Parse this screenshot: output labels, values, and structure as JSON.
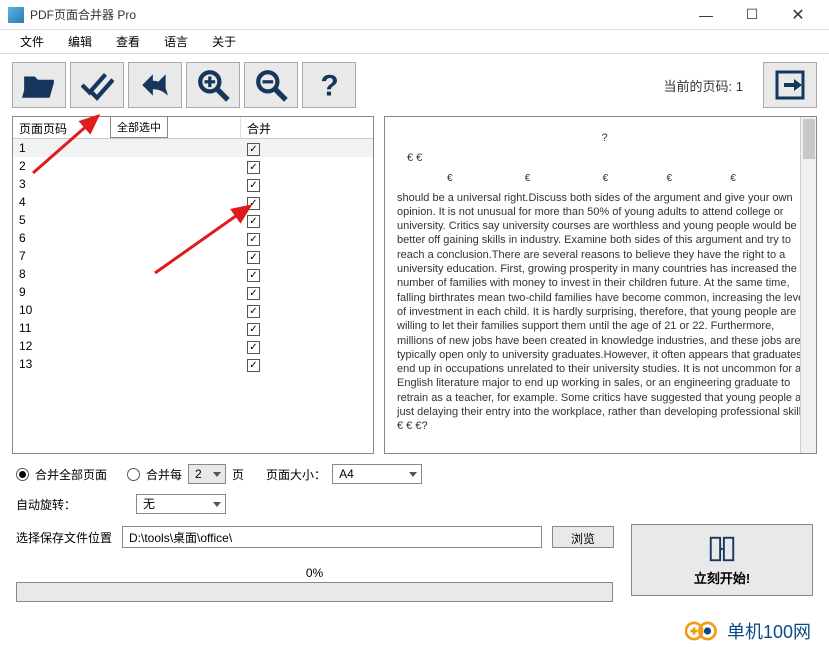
{
  "window": {
    "title": "PDF页面合并器 Pro"
  },
  "menu": {
    "file": "文件",
    "edit": "编辑",
    "view": "查看",
    "lang": "语言",
    "about": "关于"
  },
  "tooltip": "全部选中",
  "header": {
    "current_page_label": "当前的页码: 1"
  },
  "table": {
    "col_page": "页面页码",
    "col_merge": "合并",
    "rows": [
      {
        "n": "1",
        "c": true
      },
      {
        "n": "2",
        "c": true
      },
      {
        "n": "3",
        "c": true
      },
      {
        "n": "4",
        "c": true
      },
      {
        "n": "5",
        "c": true
      },
      {
        "n": "6",
        "c": true
      },
      {
        "n": "7",
        "c": true
      },
      {
        "n": "8",
        "c": true
      },
      {
        "n": "9",
        "c": true
      },
      {
        "n": "10",
        "c": true
      },
      {
        "n": "11",
        "c": true
      },
      {
        "n": "12",
        "c": true
      },
      {
        "n": "13",
        "c": true
      }
    ]
  },
  "preview": {
    "sym1": "?",
    "sym2": "€   €",
    "sym3": "€                          €                          €                     €                     €",
    "body": "should be a universal right.Discuss both sides of the argument and give your own opinion. It is not unusual for more than 50% of young adults to attend college or university. Critics say university courses are worthless and young people would be better off gaining skills in industry. Examine both sides of this argument and try to reach a conclusion.There are several reasons to believe they have the right to a university education. First, growing prosperity in many countries has increased the number of families with money to invest in their children   future. At the same time, falling birthrates mean two-child families have become common, increasing the level of investment in each child. It is hardly surprising, therefore, that young people are willing to let their families support them until the age of 21 or 22. Furthermore, millions of new jobs have been created in knowledge industries, and these jobs are typically open only to university graduates.However, it often appears that graduates end up in occupations unrelated to their university studies. It is not uncommon for an English literature major to end up working in sales, or an engineering graduate to retrain as a teacher, for example. Some critics have suggested that young people are just delaying their entry into the workplace, rather than developing professional skills.                                           €            €          €?"
  },
  "opts": {
    "merge_all": "合并全部页面",
    "merge_every": "合并每",
    "every_n": "2",
    "pages": "页",
    "page_size_label": "页面大小：",
    "page_size": "A4",
    "auto_rotate_label": "自动旋转：",
    "auto_rotate": "无",
    "save_loc_label": "选择保存文件位置",
    "save_path": "D:\\tools\\桌面\\office\\",
    "browse": "浏览",
    "progress": "0%",
    "start": "立刻开始!"
  },
  "watermark": "单机100网"
}
